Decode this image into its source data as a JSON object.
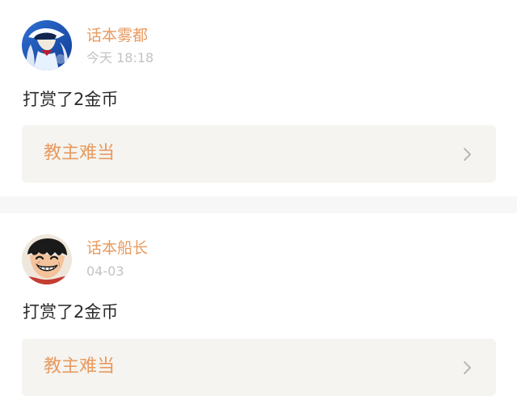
{
  "feed": {
    "items": [
      {
        "username": "话本雾都",
        "timestamp": "今天 18:18",
        "message": "打赏了2金币",
        "link_title": "教主难当",
        "avatar_icon": "kid-character-avatar",
        "chevron_icon": "chevron-right-icon"
      },
      {
        "username": "话本船长",
        "timestamp": "04-03",
        "message": "打赏了2金币",
        "link_title": "教主难当",
        "avatar_icon": "luffy-character-avatar",
        "chevron_icon": "chevron-right-icon"
      }
    ]
  },
  "theme": {
    "accent": "#e89a5f",
    "muted": "#c3c3c3",
    "text": "#2b2b2b",
    "card_bg": "#f5f4f0",
    "divider": "#f7f7f7"
  }
}
